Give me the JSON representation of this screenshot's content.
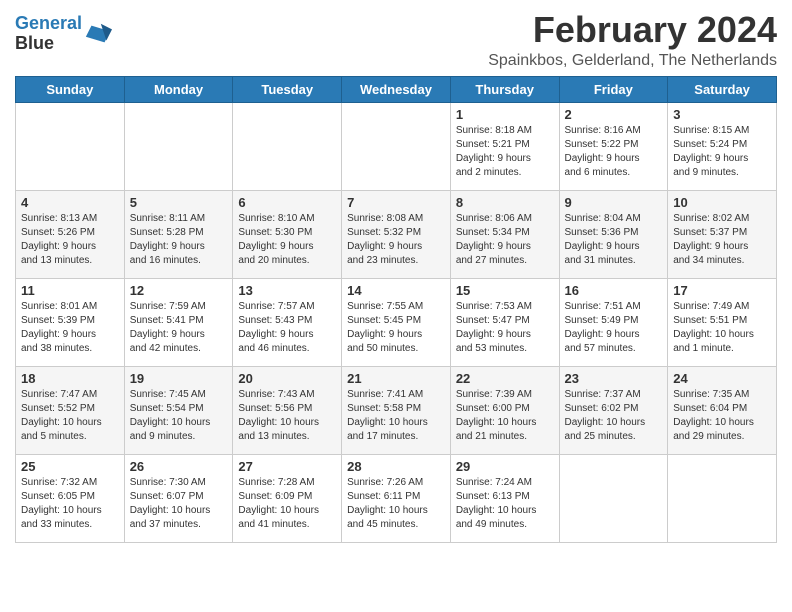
{
  "logo": {
    "line1": "General",
    "line2": "Blue"
  },
  "title": "February 2024",
  "subtitle": "Spainkbos, Gelderland, The Netherlands",
  "days_header": [
    "Sunday",
    "Monday",
    "Tuesday",
    "Wednesday",
    "Thursday",
    "Friday",
    "Saturday"
  ],
  "weeks": [
    [
      {
        "day": "",
        "info": ""
      },
      {
        "day": "",
        "info": ""
      },
      {
        "day": "",
        "info": ""
      },
      {
        "day": "",
        "info": ""
      },
      {
        "day": "1",
        "info": "Sunrise: 8:18 AM\nSunset: 5:21 PM\nDaylight: 9 hours\nand 2 minutes."
      },
      {
        "day": "2",
        "info": "Sunrise: 8:16 AM\nSunset: 5:22 PM\nDaylight: 9 hours\nand 6 minutes."
      },
      {
        "day": "3",
        "info": "Sunrise: 8:15 AM\nSunset: 5:24 PM\nDaylight: 9 hours\nand 9 minutes."
      }
    ],
    [
      {
        "day": "4",
        "info": "Sunrise: 8:13 AM\nSunset: 5:26 PM\nDaylight: 9 hours\nand 13 minutes."
      },
      {
        "day": "5",
        "info": "Sunrise: 8:11 AM\nSunset: 5:28 PM\nDaylight: 9 hours\nand 16 minutes."
      },
      {
        "day": "6",
        "info": "Sunrise: 8:10 AM\nSunset: 5:30 PM\nDaylight: 9 hours\nand 20 minutes."
      },
      {
        "day": "7",
        "info": "Sunrise: 8:08 AM\nSunset: 5:32 PM\nDaylight: 9 hours\nand 23 minutes."
      },
      {
        "day": "8",
        "info": "Sunrise: 8:06 AM\nSunset: 5:34 PM\nDaylight: 9 hours\nand 27 minutes."
      },
      {
        "day": "9",
        "info": "Sunrise: 8:04 AM\nSunset: 5:36 PM\nDaylight: 9 hours\nand 31 minutes."
      },
      {
        "day": "10",
        "info": "Sunrise: 8:02 AM\nSunset: 5:37 PM\nDaylight: 9 hours\nand 34 minutes."
      }
    ],
    [
      {
        "day": "11",
        "info": "Sunrise: 8:01 AM\nSunset: 5:39 PM\nDaylight: 9 hours\nand 38 minutes."
      },
      {
        "day": "12",
        "info": "Sunrise: 7:59 AM\nSunset: 5:41 PM\nDaylight: 9 hours\nand 42 minutes."
      },
      {
        "day": "13",
        "info": "Sunrise: 7:57 AM\nSunset: 5:43 PM\nDaylight: 9 hours\nand 46 minutes."
      },
      {
        "day": "14",
        "info": "Sunrise: 7:55 AM\nSunset: 5:45 PM\nDaylight: 9 hours\nand 50 minutes."
      },
      {
        "day": "15",
        "info": "Sunrise: 7:53 AM\nSunset: 5:47 PM\nDaylight: 9 hours\nand 53 minutes."
      },
      {
        "day": "16",
        "info": "Sunrise: 7:51 AM\nSunset: 5:49 PM\nDaylight: 9 hours\nand 57 minutes."
      },
      {
        "day": "17",
        "info": "Sunrise: 7:49 AM\nSunset: 5:51 PM\nDaylight: 10 hours\nand 1 minute."
      }
    ],
    [
      {
        "day": "18",
        "info": "Sunrise: 7:47 AM\nSunset: 5:52 PM\nDaylight: 10 hours\nand 5 minutes."
      },
      {
        "day": "19",
        "info": "Sunrise: 7:45 AM\nSunset: 5:54 PM\nDaylight: 10 hours\nand 9 minutes."
      },
      {
        "day": "20",
        "info": "Sunrise: 7:43 AM\nSunset: 5:56 PM\nDaylight: 10 hours\nand 13 minutes."
      },
      {
        "day": "21",
        "info": "Sunrise: 7:41 AM\nSunset: 5:58 PM\nDaylight: 10 hours\nand 17 minutes."
      },
      {
        "day": "22",
        "info": "Sunrise: 7:39 AM\nSunset: 6:00 PM\nDaylight: 10 hours\nand 21 minutes."
      },
      {
        "day": "23",
        "info": "Sunrise: 7:37 AM\nSunset: 6:02 PM\nDaylight: 10 hours\nand 25 minutes."
      },
      {
        "day": "24",
        "info": "Sunrise: 7:35 AM\nSunset: 6:04 PM\nDaylight: 10 hours\nand 29 minutes."
      }
    ],
    [
      {
        "day": "25",
        "info": "Sunrise: 7:32 AM\nSunset: 6:05 PM\nDaylight: 10 hours\nand 33 minutes."
      },
      {
        "day": "26",
        "info": "Sunrise: 7:30 AM\nSunset: 6:07 PM\nDaylight: 10 hours\nand 37 minutes."
      },
      {
        "day": "27",
        "info": "Sunrise: 7:28 AM\nSunset: 6:09 PM\nDaylight: 10 hours\nand 41 minutes."
      },
      {
        "day": "28",
        "info": "Sunrise: 7:26 AM\nSunset: 6:11 PM\nDaylight: 10 hours\nand 45 minutes."
      },
      {
        "day": "29",
        "info": "Sunrise: 7:24 AM\nSunset: 6:13 PM\nDaylight: 10 hours\nand 49 minutes."
      },
      {
        "day": "",
        "info": ""
      },
      {
        "day": "",
        "info": ""
      }
    ]
  ]
}
